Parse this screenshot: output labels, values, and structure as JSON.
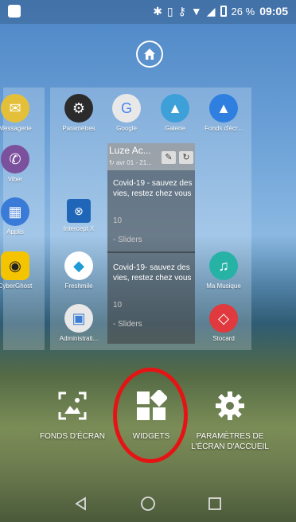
{
  "status_bar": {
    "battery": "26 %",
    "time": "09:05",
    "icons": [
      "app-notification-icon",
      "bluetooth-icon",
      "vibrate-icon",
      "key-icon",
      "wifi-icon",
      "signal-icon",
      "battery-icon"
    ]
  },
  "left_page_apps": [
    {
      "label": "Messagerie",
      "icon": "messaging-icon",
      "color": "#e4c03a"
    },
    {
      "label": "Viber",
      "icon": "viber-icon",
      "color": "#7b519d"
    },
    {
      "label": "Applis",
      "icon": "apps-icon",
      "color": "#3b7bd8"
    },
    {
      "label": "CyberGhost",
      "icon": "cyberghost-icon",
      "color": "#f5c400"
    }
  ],
  "main_page_apps": [
    {
      "label": "Paramètres",
      "icon": "gear-icon",
      "color": "#2b2b2b"
    },
    {
      "label": "Google",
      "icon": "google-folder-icon",
      "color": "#e8e8e8"
    },
    {
      "label": "Galerie",
      "icon": "gallery-icon",
      "color": "#3ea0d8"
    },
    {
      "label": "Fonds d'écr...",
      "icon": "wallpaper-icon",
      "color": "#2f7fe0"
    },
    {
      "label": "Intercept X",
      "icon": "sophos-icon",
      "color": "#1f66b8"
    },
    {
      "label": "Freshmile",
      "icon": "freshmile-icon",
      "color": "#ffffff"
    },
    {
      "label": "Ma Musique",
      "icon": "music-icon",
      "color": "#27b2a6"
    },
    {
      "label": "Administrati...",
      "icon": "admin-icon",
      "color": "#e8e8e8"
    },
    {
      "label": "Stocard",
      "icon": "stocard-icon",
      "color": "#e0393e"
    }
  ],
  "widget": {
    "title": "Luze Ac...",
    "subtitle": "avr 01 - 21...",
    "items": [
      {
        "text": "Covid-19 - sauvez des vies, restez chez vous",
        "count": "10",
        "source": "- Sliders"
      },
      {
        "text": "Covid-19- sauvez des vies, restez chez vous",
        "count": "10",
        "source": "- Sliders"
      }
    ]
  },
  "options": [
    {
      "label": "FONDS D'ÉCRAN",
      "icon": "wallpaper-option-icon"
    },
    {
      "label": "WIDGETS",
      "icon": "widgets-icon"
    },
    {
      "label": "PARAMÈTRES DE L'ÉCRAN D'ACCUEIL",
      "icon": "home-settings-icon"
    }
  ],
  "highlight_color": "#e51414"
}
